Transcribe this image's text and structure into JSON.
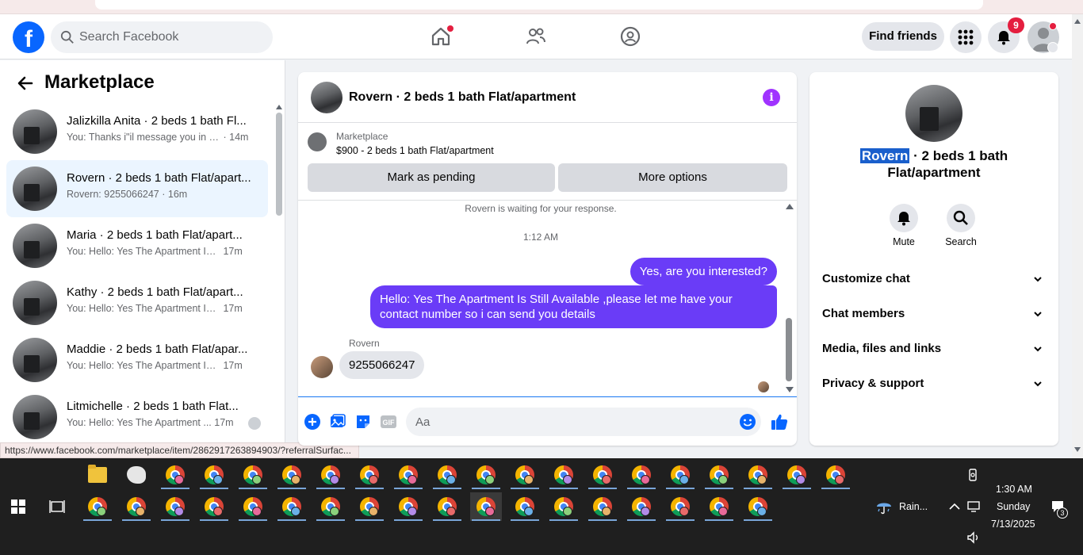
{
  "header": {
    "logo_letter": "f",
    "search_placeholder": "Search Facebook",
    "find_friends_label": "Find friends",
    "notification_count": "9"
  },
  "sidebar": {
    "title": "Marketplace",
    "conversations": [
      {
        "name": "Jalizkilla Anita · 2 beds 1 bath Fl...",
        "preview": "You: Thanks i\"il message you in a...",
        "time": "· 14m"
      },
      {
        "name": "Rovern · 2 beds 1 bath Flat/apart...",
        "preview": "Rovern: 9255066247",
        "time": "· 16m"
      },
      {
        "name": "Maria · 2 beds 1 bath Flat/apart...",
        "preview": "You: Hello: Yes The Apartment Is ...",
        "time": "17m"
      },
      {
        "name": "Kathy · 2 beds 1 bath Flat/apart...",
        "preview": "You: Hello: Yes The Apartment Is ...",
        "time": "17m"
      },
      {
        "name": "Maddie · 2 beds 1 bath Flat/apar...",
        "preview": "You: Hello: Yes The Apartment Is ...",
        "time": "17m"
      },
      {
        "name": "Litmichelle · 2 beds 1 bath Flat...",
        "preview": "You: Hello: Yes The Apartment ...",
        "time": "17m"
      }
    ]
  },
  "status_url": "https://www.facebook.com/marketplace/item/2862917263894903/?referralSurfac...",
  "chat": {
    "title": "Rovern · 2 beds 1 bath Flat/apartment",
    "listing_source": "Marketplace",
    "listing_desc": "$900 - 2 beds 1 bath Flat/apartment",
    "mark_pending_label": "Mark as pending",
    "more_options_label": "More options",
    "waiting_text": "Rovern is waiting for your response.",
    "timestamp": "1:12 AM",
    "messages": {
      "out1": "Yes, are you interested?",
      "out2": "Hello: Yes The Apartment Is Still Available ,please let me have your contact number so i can send you details",
      "sender": "Rovern",
      "in1": "9255066247"
    },
    "composer_placeholder": "Aa"
  },
  "details": {
    "name_highlight": "Rovern",
    "title_rest": " · 2 beds 1 bath Flat/apartment",
    "mute_label": "Mute",
    "search_label": "Search",
    "sections": [
      "Customize chat",
      "Chat members",
      "Media, files and links",
      "Privacy & support"
    ]
  },
  "taskbar": {
    "weather_text": "Rain...",
    "time": "1:30 AM",
    "day": "Sunday",
    "date": "7/13/2025",
    "notification_count": "3"
  },
  "colors": {
    "brand_blue": "#0866ff",
    "bubble_purple": "#6a3cf7",
    "info_purple": "#a033ff",
    "alert_red": "#e41e3f",
    "active_row": "#ebf5ff"
  }
}
